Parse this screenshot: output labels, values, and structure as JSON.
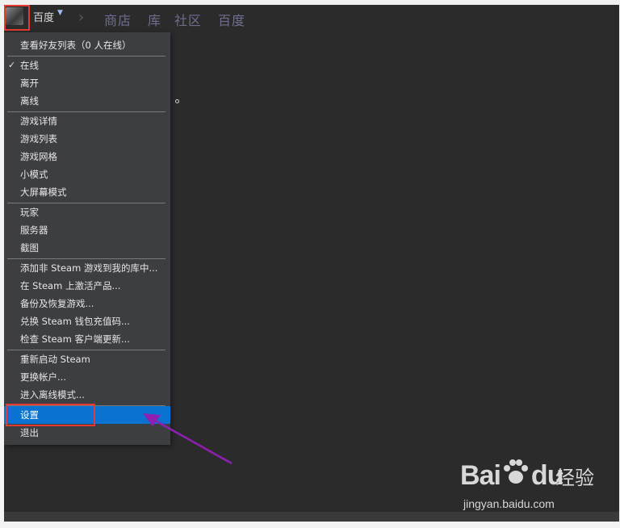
{
  "header": {
    "profile_name": "百度",
    "nav_tabs": [
      "商店",
      "库",
      "社区",
      "百度"
    ]
  },
  "menu": {
    "items": [
      "查看好友列表（0 人在线）",
      "在线",
      "离开",
      "离线",
      "游戏详情",
      "游戏列表",
      "游戏网格",
      "小模式",
      "大屏幕模式",
      "玩家",
      "服务器",
      "截图",
      "添加非 Steam 游戏到我的库中...",
      "在 Steam 上激活产品...",
      "备份及恢复游戏...",
      "兑换 Steam 钱包充值码...",
      "检查 Steam 客户端更新...",
      "重新启动 Steam",
      "更换帐户...",
      "进入离线模式...",
      "设置",
      "退出"
    ],
    "checked_index": 1,
    "selected_index": 20
  },
  "watermark": {
    "brand": "Bai",
    "brand_suffix": "du",
    "cn": "经验",
    "url": "jingyan.baidu.com"
  },
  "colors": {
    "menu_bg": "#3d3e42",
    "selected_bg": "#0a72d1",
    "highlight": "#e53935",
    "arrow": "#8e1fb0"
  }
}
